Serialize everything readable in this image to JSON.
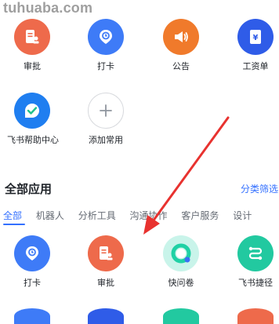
{
  "watermark": "tuhuaba.com",
  "common_apps": [
    {
      "label": "审批",
      "icon": "approval-icon",
      "color": "#ee6a4b"
    },
    {
      "label": "打卡",
      "icon": "clock-in-icon",
      "color": "#3e7bf7"
    },
    {
      "label": "公告",
      "icon": "announcement-icon",
      "color": "#f07a2b"
    },
    {
      "label": "工资单",
      "icon": "payslip-icon",
      "color": "#2f5ce8"
    },
    {
      "label": "飞书帮助中心",
      "icon": "help-center-icon",
      "color": "#3e7bf7"
    },
    {
      "label": "添加常用",
      "icon": "add-icon",
      "color": "#ffffff"
    }
  ],
  "all_apps": {
    "title": "全部应用",
    "filter_label": "分类筛选",
    "tabs": [
      "全部",
      "机器人",
      "分析工具",
      "沟通协作",
      "客户服务",
      "设计"
    ],
    "active_tab": "全部",
    "apps": [
      {
        "label": "打卡",
        "icon": "clock-in-icon",
        "color": "#3e7bf7"
      },
      {
        "label": "审批",
        "icon": "approval-icon",
        "color": "#ee6a4b"
      },
      {
        "label": "快问卷",
        "icon": "survey-icon",
        "color": "#c9f4ea"
      },
      {
        "label": "飞书捷径",
        "icon": "shortcut-icon",
        "color": "#22c9a0"
      }
    ]
  },
  "accent_color": "#3370ff",
  "annotation_arrow_color": "#e8322f"
}
